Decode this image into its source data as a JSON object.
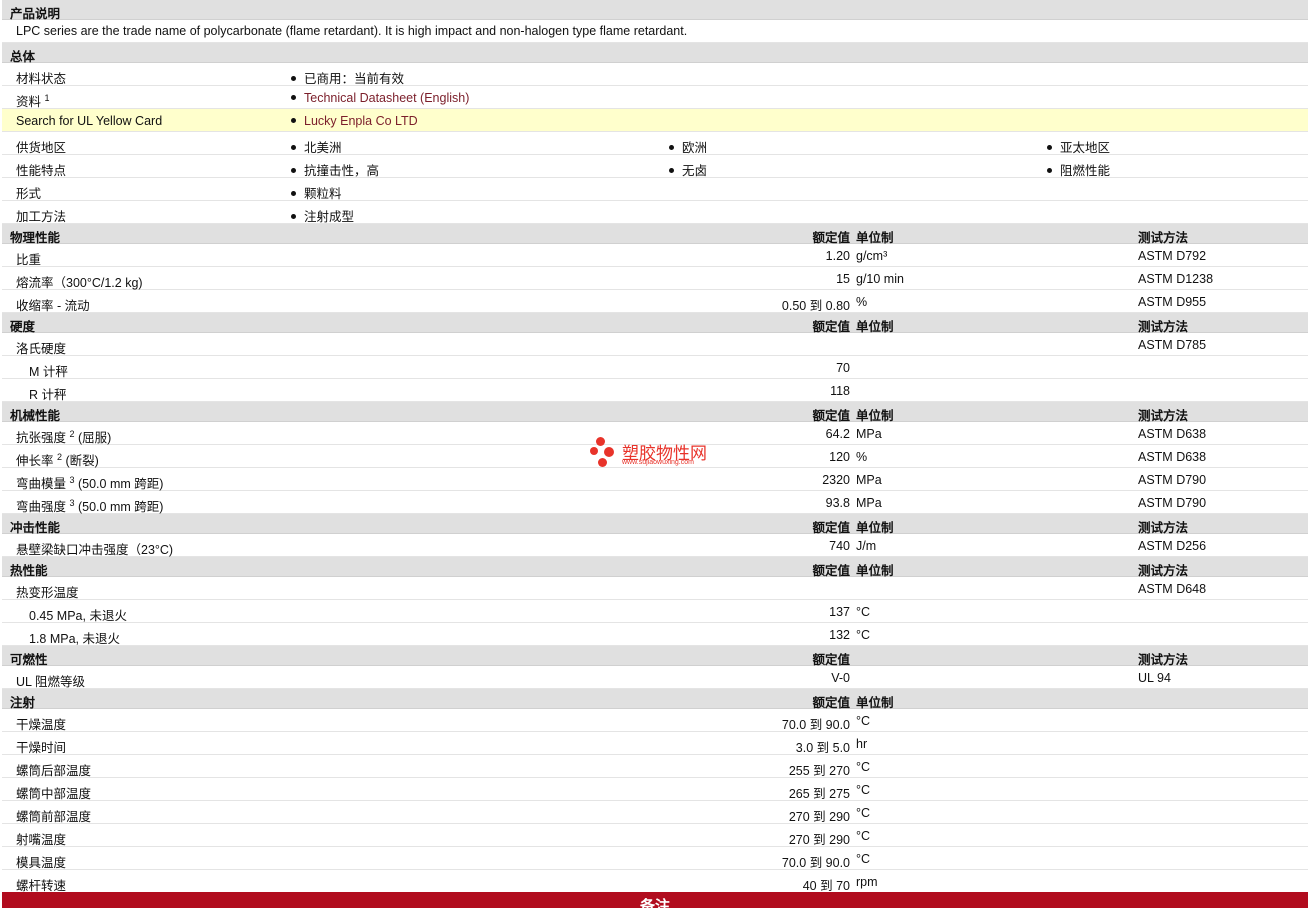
{
  "sections": [
    {
      "type": "section",
      "title": "产品说明"
    },
    {
      "type": "desc",
      "text": "LPC series are the trade name of polycarbonate (flame retardant). It is high impact and non-halogen type flame retardant."
    },
    {
      "type": "section",
      "title": "总体"
    },
    {
      "type": "gen",
      "label": "材料状态",
      "items": [
        {
          "text": "已商用：当前有效"
        }
      ]
    },
    {
      "type": "gen",
      "label": "资料",
      "sup": "1",
      "items": [
        {
          "text": "Technical Datasheet (English)",
          "link": true
        }
      ]
    },
    {
      "type": "gen",
      "label": "Search for UL Yellow Card",
      "highlight": true,
      "items": [
        {
          "text": "Lucky Enpla Co LTD",
          "link": true
        }
      ]
    },
    {
      "type": "gen",
      "label": "供货地区",
      "items": [
        {
          "text": "北美洲"
        },
        {
          "text": "欧洲"
        },
        {
          "text": "亚太地区"
        }
      ]
    },
    {
      "type": "gen",
      "label": "性能特点",
      "items": [
        {
          "text": "抗撞击性，高"
        },
        {
          "text": "无卤"
        },
        {
          "text": "阻燃性能"
        }
      ]
    },
    {
      "type": "gen",
      "label": "形式",
      "items": [
        {
          "text": "颗粒料"
        }
      ]
    },
    {
      "type": "gen",
      "label": "加工方法",
      "items": [
        {
          "text": "注射成型"
        }
      ]
    },
    {
      "type": "section",
      "title": "物理性能",
      "h_value": "额定值",
      "h_unit": "单位制",
      "h_method": "测试方法"
    },
    {
      "type": "prop",
      "label": "比重",
      "value": "1.20",
      "unit": "g/cm³",
      "method": "ASTM D792"
    },
    {
      "type": "prop",
      "label": "熔流率（300°C/1.2 kg)",
      "value": "15",
      "unit": "g/10 min",
      "method": "ASTM D1238"
    },
    {
      "type": "prop",
      "label": "收缩率 - 流动",
      "value": "0.50 到 0.80",
      "unit": "%",
      "method": "ASTM D955"
    },
    {
      "type": "section",
      "title": "硬度",
      "h_value": "额定值",
      "h_unit": "单位制",
      "h_method": "测试方法"
    },
    {
      "type": "prop",
      "label": "洛氏硬度",
      "value": "",
      "unit": "",
      "method": "ASTM D785"
    },
    {
      "type": "prop",
      "label": "M 计秤",
      "sub": true,
      "value": "70",
      "unit": "",
      "method": ""
    },
    {
      "type": "prop",
      "label": "R 计秤",
      "sub": true,
      "value": "118",
      "unit": "",
      "method": ""
    },
    {
      "type": "section",
      "title": "机械性能",
      "h_value": "额定值",
      "h_unit": "单位制",
      "h_method": "测试方法"
    },
    {
      "type": "prop",
      "label": "抗张强度",
      "sup": "2",
      "suffix": " (屈服)",
      "value": "64.2",
      "unit": "MPa",
      "method": "ASTM D638"
    },
    {
      "type": "prop",
      "label": "伸长率",
      "sup": "2",
      "suffix": " (断裂)",
      "value": "120",
      "unit": "%",
      "method": "ASTM D638"
    },
    {
      "type": "prop",
      "label": "弯曲模量",
      "sup": "3",
      "suffix": " (50.0 mm 跨距)",
      "value": "2320",
      "unit": "MPa",
      "method": "ASTM D790"
    },
    {
      "type": "prop",
      "label": "弯曲强度",
      "sup": "3",
      "suffix": " (50.0 mm 跨距)",
      "value": "93.8",
      "unit": "MPa",
      "method": "ASTM D790"
    },
    {
      "type": "section",
      "title": "冲击性能",
      "h_value": "额定值",
      "h_unit": "单位制",
      "h_method": "测试方法"
    },
    {
      "type": "prop",
      "label": "悬壁梁缺口冲击强度（23°C)",
      "value": "740",
      "unit": "J/m",
      "method": "ASTM D256"
    },
    {
      "type": "section",
      "title": "热性能",
      "h_value": "额定值",
      "h_unit": "单位制",
      "h_method": "测试方法"
    },
    {
      "type": "prop",
      "label": "热变形温度",
      "value": "",
      "unit": "",
      "method": "ASTM D648"
    },
    {
      "type": "prop",
      "label": "0.45 MPa, 未退火",
      "sub": true,
      "value": "137",
      "unit": "°C",
      "method": ""
    },
    {
      "type": "prop",
      "label": "1.8 MPa, 未退火",
      "sub": true,
      "value": "132",
      "unit": "°C",
      "method": ""
    },
    {
      "type": "section",
      "title": "可燃性",
      "h_value": "额定值",
      "h_method": "测试方法"
    },
    {
      "type": "prop",
      "label": "UL 阻燃等级",
      "value": "V-0",
      "unit": "",
      "method": "UL 94"
    },
    {
      "type": "section",
      "title": "注射",
      "h_value": "额定值",
      "h_unit": "单位制"
    },
    {
      "type": "prop",
      "label": "干燥温度",
      "value": "70.0 到 90.0",
      "unit": "°C",
      "method": ""
    },
    {
      "type": "prop",
      "label": "干燥时间",
      "value": "3.0 到 5.0",
      "unit": "hr",
      "method": ""
    },
    {
      "type": "prop",
      "label": "螺筒后部温度",
      "value": "255 到 270",
      "unit": "°C",
      "method": ""
    },
    {
      "type": "prop",
      "label": "螺筒中部温度",
      "value": "265 到 275",
      "unit": "°C",
      "method": ""
    },
    {
      "type": "prop",
      "label": "螺筒前部温度",
      "value": "270 到 290",
      "unit": "°C",
      "method": ""
    },
    {
      "type": "prop",
      "label": "射嘴温度",
      "value": "270 到 290",
      "unit": "°C",
      "method": ""
    },
    {
      "type": "prop",
      "label": "模具温度",
      "value": "70.0 到 90.0",
      "unit": "°C",
      "method": ""
    },
    {
      "type": "prop",
      "label": "螺杆转速",
      "value": "40 到 70",
      "unit": "rpm",
      "method": ""
    }
  ],
  "notes_label": "备注",
  "watermark": {
    "title": "塑胶物性网",
    "url": "www.sujiaowuxing.com"
  },
  "colors": {
    "section_bg": "#e0e0e0",
    "highlight": "#ffffcc",
    "link": "#7b1e2a",
    "notes_bar": "#b10c1e",
    "watermark": "#e8332a"
  }
}
